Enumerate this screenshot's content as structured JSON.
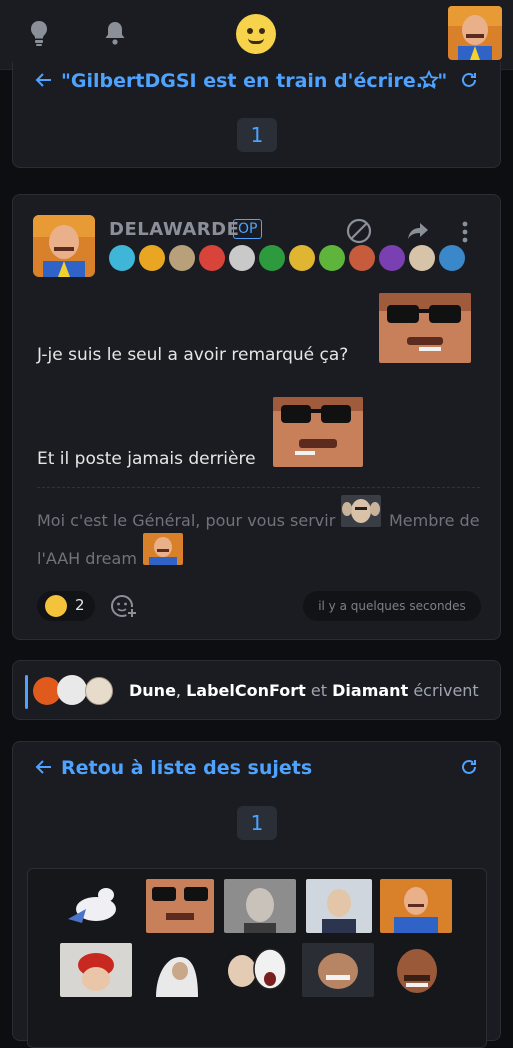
{
  "topbar": {
    "icons": [
      "lightbulb-icon",
      "bell-icon",
      "smiley-icon",
      "user-avatar"
    ]
  },
  "thread_header": {
    "title": "\"GilbertDGSI est en train d'écrire...\"",
    "page": "1"
  },
  "post": {
    "author": "DELAWARDE",
    "op_label": "OP",
    "line1": "J-je suis le seul a avoir remarqué ça?",
    "line2": "Et il poste jamais derrière",
    "signature_a": "Moi c'est le Général, pour vous servir",
    "signature_b": "Membre de",
    "signature_c": "l'AAH dream",
    "reaction_count": "2",
    "timestamp": "il y a quelques secondes"
  },
  "typing": {
    "user1": "Dune",
    "sep": ",",
    "user2": "LabelConFort",
    "and": "et",
    "user3": "Diamant",
    "verb": "écrivent"
  },
  "nav": {
    "back_label": "Retou à liste des sujets",
    "page": "1"
  },
  "colors": {
    "accent": "#4da3ff",
    "background": "#0d0e11",
    "card": "#1a1c21"
  }
}
